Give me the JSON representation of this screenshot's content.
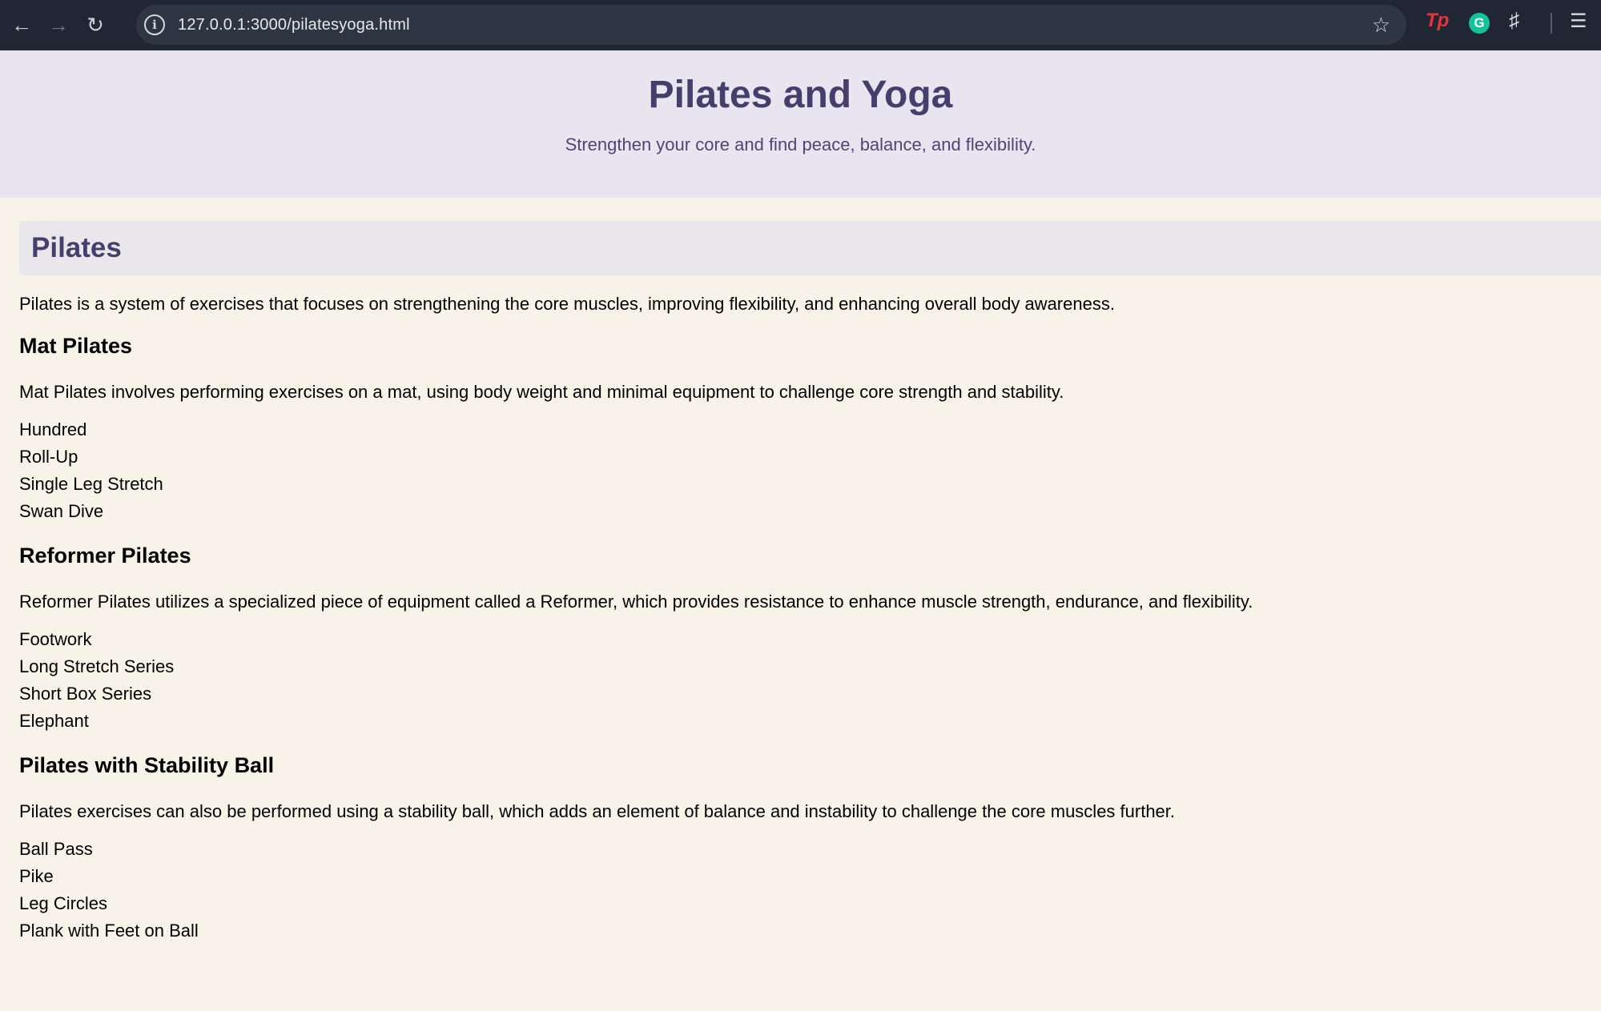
{
  "browser": {
    "url": "127.0.0.1:3000/pilatesyoga.html",
    "nav_icons": [
      "back-arrow-icon",
      "forward-arrow-icon",
      "reload-icon"
    ],
    "extension_icons": [
      "tp-extension-icon",
      "grammarly-icon",
      "puzzle-extensions-icon",
      "media-control-icon"
    ],
    "tp_label": "Tp",
    "grammarly_label": "G"
  },
  "header": {
    "title": "Pilates and Yoga",
    "subtitle": "Strengthen your core and find peace, balance, and flexibility."
  },
  "section": {
    "title": "Pilates",
    "intro": "Pilates is a system of exercises that focuses on strengthening the core muscles, improving flexibility, and enhancing overall body awareness.",
    "subsections": [
      {
        "title": "Mat Pilates",
        "description": "Mat Pilates involves performing exercises on a mat, using body weight and minimal equipment to challenge core strength and stability.",
        "exercises": [
          "Hundred",
          "Roll-Up",
          "Single Leg Stretch",
          "Swan Dive"
        ]
      },
      {
        "title": "Reformer Pilates",
        "description": "Reformer Pilates utilizes a specialized piece of equipment called a Reformer, which provides resistance to enhance muscle strength, endurance, and flexibility.",
        "exercises": [
          "Footwork",
          "Long Stretch Series",
          "Short Box Series",
          "Elephant"
        ]
      },
      {
        "title": "Pilates with Stability Ball",
        "description": "Pilates exercises can also be performed using a stability ball, which adds an element of balance and instability to challenge the core muscles further.",
        "exercises": [
          "Ball Pass",
          "Pike",
          "Leg Circles",
          "Plank with Feet on Ball"
        ]
      }
    ]
  },
  "colors": {
    "page_bg": "#f7f3e9",
    "header_bg": "#e8e5f1",
    "accent": "#463f6c",
    "chrome_bg": "#202633"
  }
}
